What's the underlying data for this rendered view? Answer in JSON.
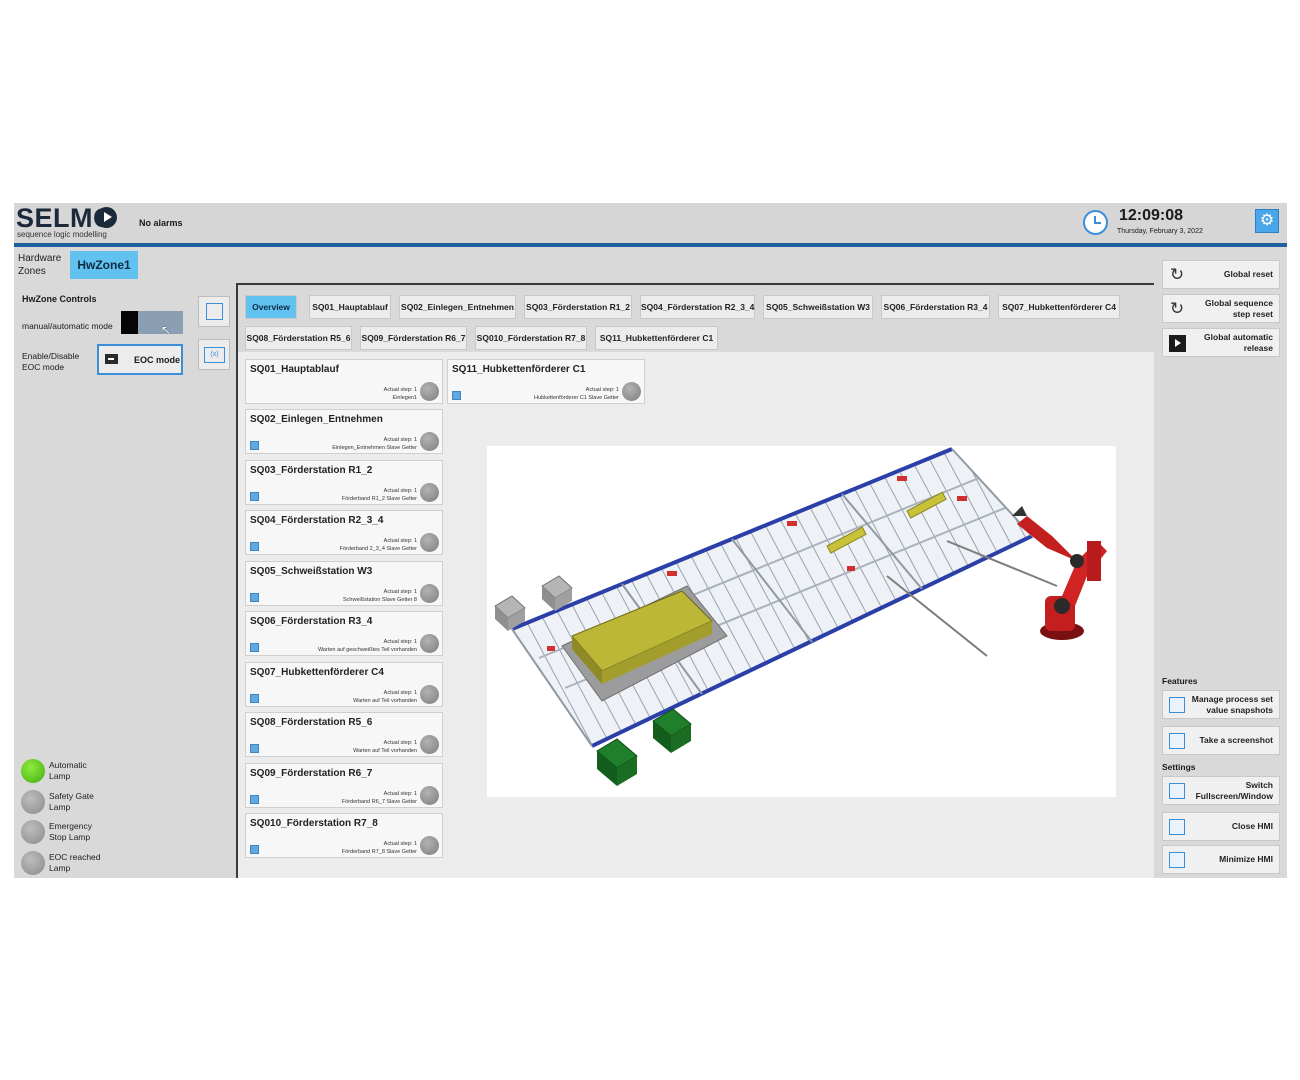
{
  "header": {
    "logo": "SELMO",
    "logo_subtitle": "sequence logic modelling",
    "alarm_status": "No alarms",
    "time": "12:09:08",
    "date": "Thursday, February 3, 2022",
    "settings_icon": "gear-icon",
    "clock_icon": "clock-icon"
  },
  "left": {
    "hw_zones_label": "Hardware\nZones",
    "hw_zone_tab": "HwZone1",
    "controls_title": "HwZone Controls",
    "mode_label": "manual/automatic mode",
    "eoc_label": "Enable/Disable\nEOC mode",
    "eoc_button": "EOC mode",
    "lamps": [
      {
        "label": "Automatic\nLamp",
        "on": true
      },
      {
        "label": "Safety Gate\nLamp",
        "on": false
      },
      {
        "label": "Emergency\nStop Lamp",
        "on": false
      },
      {
        "label": "EOC reached\nLamp",
        "on": false
      }
    ]
  },
  "tabs": [
    {
      "label": "Overview",
      "active": true
    },
    {
      "label": "SQ01_Hauptablauf"
    },
    {
      "label": "SQ02_Einlegen_Entnehmen"
    },
    {
      "label": "SQ03_Förderstation R1_2"
    },
    {
      "label": "SQ04_Förderstation R2_3_4"
    },
    {
      "label": "SQ05_Schweißstation W3"
    },
    {
      "label": "SQ06_Förderstation R3_4"
    },
    {
      "label": "SQ07_Hubkettenförderer C4"
    },
    {
      "label": "SQ08_Förderstation R5_6"
    },
    {
      "label": "SQ09_Förderstation R6_7"
    },
    {
      "label": "SQ010_Förderstation R7_8"
    },
    {
      "label": "SQ11_Hubkettenförderer C1"
    }
  ],
  "sequences": [
    {
      "title": "SQ01_Hauptablauf",
      "actual_step": "Actual step: 1",
      "step_label": "Einlegen1"
    },
    {
      "title": "SQ11_Hubkettenförderer C1",
      "actual_step": "Actual step: 1",
      "step_label": "Hubkettenförderer C1 Slave Getter"
    },
    {
      "title": "SQ02_Einlegen_Entnehmen",
      "actual_step": "Actual step: 1",
      "step_label": "Einlegen_Entnehmen Slave Getter"
    },
    {
      "title": "SQ03_Förderstation R1_2",
      "actual_step": "Actual step: 1",
      "step_label": "Förderband R1_2 Slave Getter"
    },
    {
      "title": "SQ04_Förderstation R2_3_4",
      "actual_step": "Actual step: 1",
      "step_label": "Förderband 2_3_4 Slave Getter"
    },
    {
      "title": "SQ05_Schweißstation W3",
      "actual_step": "Actual step: 1",
      "step_label": "Schweißstation Slave Getter 8"
    },
    {
      "title": "SQ06_Förderstation R3_4",
      "actual_step": "Actual step: 1",
      "step_label": "Warten auf geschweißtes Teil vorhanden"
    },
    {
      "title": "SQ07_Hubkettenförderer C4",
      "actual_step": "Actual step: 1",
      "step_label": "Warten auf Teil vorhanden"
    },
    {
      "title": "SQ08_Förderstation R5_6",
      "actual_step": "Actual step: 1",
      "step_label": "Warten auf Teil vorhanden"
    },
    {
      "title": "SQ09_Förderstation R6_7",
      "actual_step": "Actual step: 1",
      "step_label": "Förderband R6_7 Slave Getter"
    },
    {
      "title": "SQ010_Förderstation R7_8",
      "actual_step": "Actual step: 1",
      "step_label": "Förderband R7_8 Slave Getter"
    }
  ],
  "right": {
    "global_reset": "Global reset",
    "global_sequence_step_reset": "Global sequence\nstep reset",
    "global_automatic_release": "Global automatic\nrelease",
    "features_title": "Features",
    "manage_snapshots": "Manage process set\nvalue snapshots",
    "take_screenshot": "Take a screenshot",
    "settings_title": "Settings",
    "switch_fullscreen": "Switch\nFullscreen/Window",
    "close_hmi": "Close HMI",
    "minimize_hmi": "Minimize HMI"
  },
  "colors": {
    "accent": "#61c2ef",
    "header_line": "#1f5f9f",
    "lamp_on": "#3fae12",
    "lamp_off": "#8a8a8a"
  }
}
